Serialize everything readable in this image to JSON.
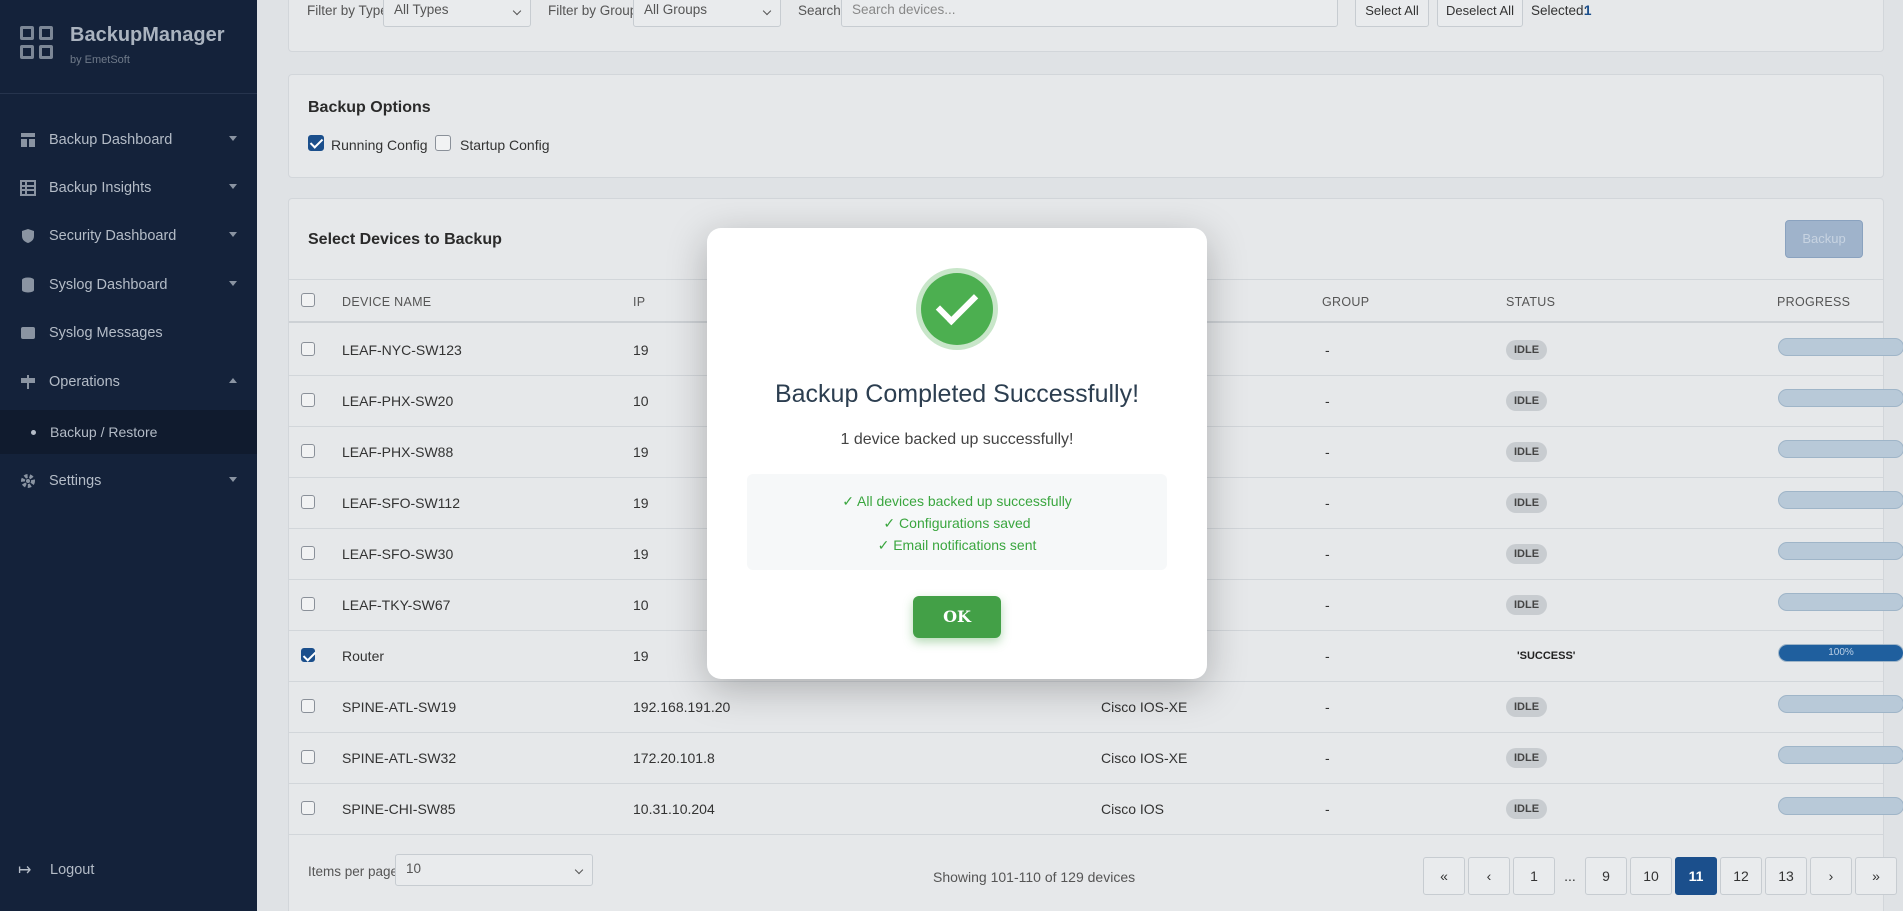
{
  "app": {
    "title": "BackupManager",
    "subtitle": "by EmetSoft"
  },
  "sidebar": {
    "items": [
      {
        "label": "Backup Dashboard",
        "icon": "dashboard-icon"
      },
      {
        "label": "Backup Insights",
        "icon": "table-icon"
      },
      {
        "label": "Security Dashboard",
        "icon": "shield-icon"
      },
      {
        "label": "Syslog Dashboard",
        "icon": "database-icon"
      },
      {
        "label": "Syslog Messages",
        "icon": "message-icon"
      },
      {
        "label": "Operations",
        "icon": "signpost-icon"
      },
      {
        "label": "Settings",
        "icon": "gear-icon"
      }
    ],
    "sub_item": "Backup / Restore",
    "logout": "Logout"
  },
  "filters": {
    "type_label": "Filter by Type:",
    "type_value": "All Types",
    "group_label": "Filter by Group:",
    "group_value": "All Groups",
    "search_label": "Search:",
    "search_placeholder": "Search devices...",
    "select_all": "Select All",
    "deselect_all": "Deselect All",
    "selected_label": "Selected:",
    "selected_count": "1"
  },
  "options": {
    "title": "Backup Options",
    "running_config": "Running Config",
    "startup_config": "Startup Config"
  },
  "devices": {
    "title": "Select Devices to Backup",
    "backup_button": "Backup",
    "columns": {
      "name": "DEVICE NAME",
      "ip": "IP",
      "group": "GROUP",
      "status": "STATUS",
      "progress": "PROGRESS"
    },
    "rows": [
      {
        "name": "LEAF-NYC-SW123",
        "ip": "19",
        "type": "",
        "group": "-",
        "status": "IDLE",
        "checked": false,
        "progress": 0
      },
      {
        "name": "LEAF-PHX-SW20",
        "ip": "10",
        "type": "",
        "group": "-",
        "status": "IDLE",
        "checked": false,
        "progress": 0
      },
      {
        "name": "LEAF-PHX-SW88",
        "ip": "19",
        "type": "",
        "group": "-",
        "status": "IDLE",
        "checked": false,
        "progress": 0
      },
      {
        "name": "LEAF-SFO-SW112",
        "ip": "19",
        "type": "",
        "group": "-",
        "status": "IDLE",
        "checked": false,
        "progress": 0
      },
      {
        "name": "LEAF-SFO-SW30",
        "ip": "19",
        "type": "",
        "group": "-",
        "status": "IDLE",
        "checked": false,
        "progress": 0
      },
      {
        "name": "LEAF-TKY-SW67",
        "ip": "10",
        "type": "",
        "group": "-",
        "status": "IDLE",
        "checked": false,
        "progress": 0
      },
      {
        "name": "Router",
        "ip": "19",
        "type": "",
        "group": "-",
        "status": "'SUCCESS'",
        "checked": true,
        "progress": 100,
        "progress_label": "100%"
      },
      {
        "name": "SPINE-ATL-SW19",
        "ip": "192.168.191.20",
        "type": "Cisco IOS-XE",
        "group": "-",
        "status": "IDLE",
        "checked": false,
        "progress": 0
      },
      {
        "name": "SPINE-ATL-SW32",
        "ip": "172.20.101.8",
        "type": "Cisco IOS-XE",
        "group": "-",
        "status": "IDLE",
        "checked": false,
        "progress": 0
      },
      {
        "name": "SPINE-CHI-SW85",
        "ip": "10.31.10.204",
        "type": "Cisco IOS",
        "group": "-",
        "status": "IDLE",
        "checked": false,
        "progress": 0
      }
    ],
    "items_per_page_label": "Items per page:",
    "items_per_page": "10",
    "showing": "Showing 101-110 of 129 devices",
    "pages": [
      "«",
      "‹",
      "1",
      "...",
      "9",
      "10",
      "11",
      "12",
      "13",
      "›",
      "»"
    ],
    "active_page": "11"
  },
  "modal": {
    "title": "Backup Completed Successfully!",
    "message": "1 device backed up successfully!",
    "details": [
      "✓ All devices backed up successfully",
      "✓ Configurations saved",
      "✓ Email notifications sent"
    ],
    "ok": "OK"
  },
  "colors": {
    "sidebar": "#14223a",
    "accent": "#1b4f8c",
    "success": "#4caf50"
  }
}
